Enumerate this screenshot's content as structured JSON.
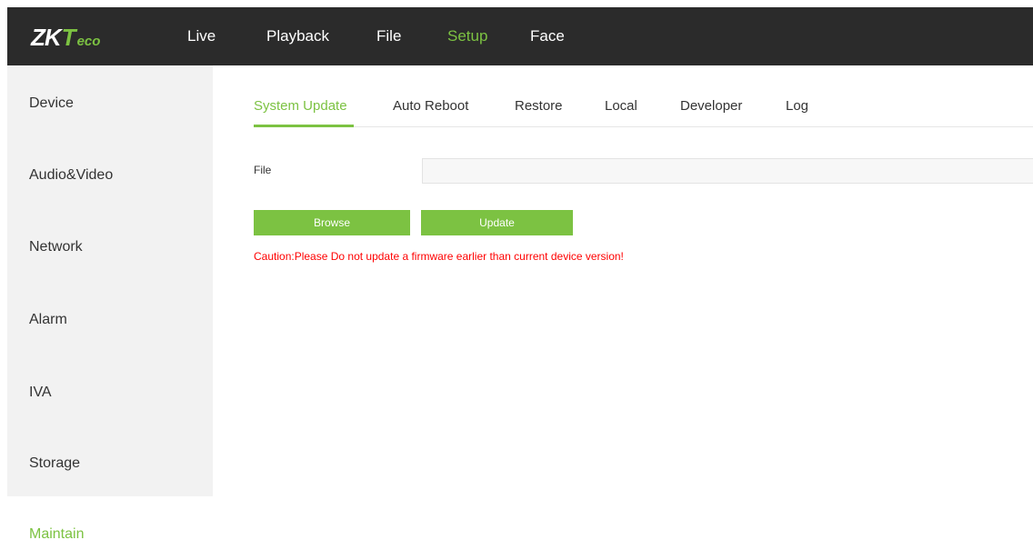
{
  "brand": {
    "logo_zk": "ZK",
    "logo_t": "T",
    "logo_eco": "eco",
    "primary_color": "#7cc242",
    "topbar_color": "#2b2b2b",
    "warning_color": "#ff0000"
  },
  "top_nav": {
    "items": [
      {
        "label": "Live"
      },
      {
        "label": "Playback"
      },
      {
        "label": "File"
      },
      {
        "label": "Setup"
      },
      {
        "label": "Face"
      }
    ],
    "active": "Setup"
  },
  "sidebar": {
    "items": [
      {
        "label": "Device"
      },
      {
        "label": "Audio&Video"
      },
      {
        "label": "Network"
      },
      {
        "label": "Alarm"
      },
      {
        "label": "IVA"
      },
      {
        "label": "Storage"
      },
      {
        "label": "Maintain"
      }
    ],
    "active": "Maintain"
  },
  "tabs": {
    "items": [
      {
        "label": "System Update"
      },
      {
        "label": "Auto Reboot"
      },
      {
        "label": "Restore"
      },
      {
        "label": "Local"
      },
      {
        "label": "Developer"
      },
      {
        "label": "Log"
      }
    ],
    "active": "System Update"
  },
  "system_update": {
    "file_label": "File",
    "file_value": "",
    "browse_label": "Browse",
    "update_label": "Update",
    "caution": "Caution:Please Do not update a firmware earlier than current device version!"
  }
}
